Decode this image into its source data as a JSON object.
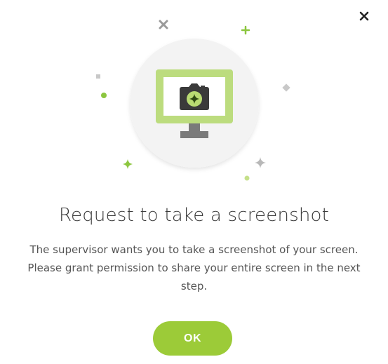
{
  "dialog": {
    "title": "Request to take a screenshot",
    "message": "The supervisor wants you to take a screenshot of your screen. Please grant permission to share your entire screen in the next step.",
    "ok_label": "OK",
    "close_icon": "close-icon"
  },
  "illustration": {
    "icon": "monitor-camera-icon",
    "accent_color": "#bcdc7e",
    "sparkle_color": "#8cc63f",
    "decor_gray": "#c8c8c8"
  },
  "colors": {
    "button": "#9ccb38",
    "title": "#3a3a3a",
    "text": "#555555"
  }
}
